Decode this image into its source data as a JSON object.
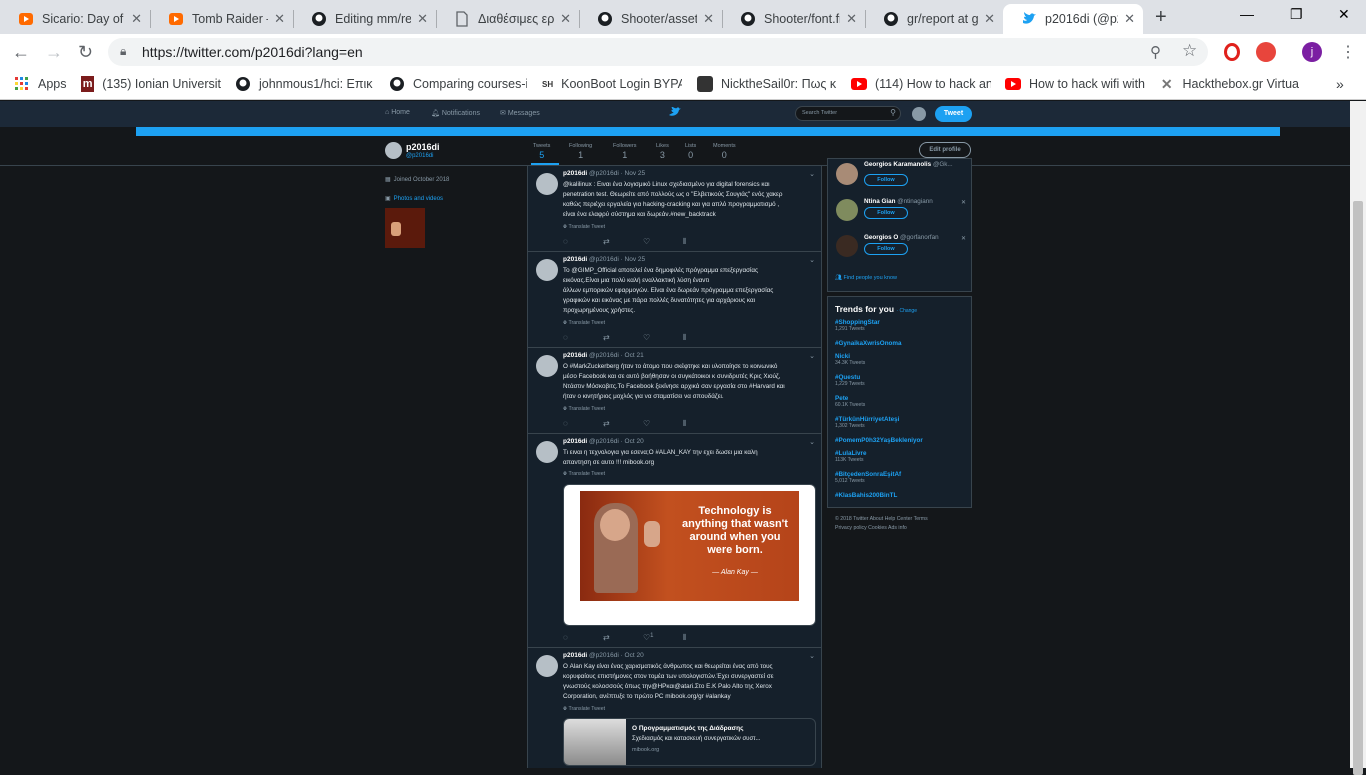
{
  "browser": {
    "tabs": [
      {
        "title": "Sicario: Day of",
        "icon": "youtube-icon"
      },
      {
        "title": "Tomb Raider –",
        "icon": "youtube-icon"
      },
      {
        "title": "Editing mm/re",
        "icon": "github-icon"
      },
      {
        "title": "Διαθέσιμες ερ",
        "icon": "document-icon"
      },
      {
        "title": "Shooter/assets",
        "icon": "github-icon"
      },
      {
        "title": "Shooter/font.fr",
        "icon": "github-icon"
      },
      {
        "title": "gr/report at gi",
        "icon": "github-icon"
      },
      {
        "title": "p2016di (@p2",
        "icon": "twitter-icon",
        "active": true
      }
    ],
    "url": "https://twitter.com/p2016di?lang=en",
    "profile_initial": "j",
    "bookmarks": [
      {
        "label": "Apps"
      },
      {
        "label": "(135) Ionian Universit"
      },
      {
        "label": "johnmous1/hci: Επικ"
      },
      {
        "label": "Comparing courses-i"
      },
      {
        "label": "KoonBoot Login BYPA"
      },
      {
        "label": "NicktheSail0r: Πως κ"
      },
      {
        "label": "(114) How to hack an"
      },
      {
        "label": "How to hack wifi with"
      },
      {
        "label": "Hackthebox.gr Virtua"
      }
    ],
    "bookmarks_more": "»",
    "bookmark_icon_texts": {
      "ionian": "m",
      "koonboot": "SH"
    }
  },
  "twitter": {
    "nav": {
      "home": "Home",
      "notifications": "Notifications",
      "messages": "Messages",
      "search_placeholder": "Search Twitter",
      "tweet_button": "Tweet"
    },
    "profile": {
      "name": "p2016di",
      "handle": "@p2016di",
      "joined": "Joined October 2018",
      "photos_label": "Photos and videos",
      "edit": "Edit profile",
      "stats": [
        {
          "label": "Tweets",
          "value": "5",
          "active": true
        },
        {
          "label": "Following",
          "value": "1"
        },
        {
          "label": "Followers",
          "value": "1"
        },
        {
          "label": "Likes",
          "value": "3"
        },
        {
          "label": "Lists",
          "value": "0"
        },
        {
          "label": "Moments",
          "value": "0"
        }
      ]
    },
    "translate_label": "Translate Tweet",
    "tweets": [
      {
        "name": "p2016di",
        "handle": "@p2016di",
        "date": "Nov 25",
        "text": [
          "@kalilinux : Ειναι ένα λογισμικό Linux σχεδιασμένο για digital forensics και",
          "penetration test. Θεωρείτε από πολλούς ως ο \"Ελβετικούς Σουγιάς\" ενός χακερ",
          "καθώς περιέχει εργαλεία για hacking-cracking και για απλό  προγραμματισμό ,",
          "είναι ένα ελαφρύ σύστημα και δωρεάν.#new_backtrack"
        ]
      },
      {
        "name": "p2016di",
        "handle": "@p2016di",
        "date": "Nov 25",
        "text": [
          "Το @GIMP_Official αποτελεί ένα δημοφιλές πρόγραμμα επεξεργασίας",
          "εικόνας.Είναι μια πολύ καλή εναλλακτική λύση έναντι",
          "άλλων εμπορικών εφαρμογών. Είναι ένα δωρεάν πρόγραμμα επεξεργασίας",
          "γραφικών και εικόνας με πάρα πολλές δυνατότητες για αρχάριους και",
          "προχωρημένους χρήστες."
        ]
      },
      {
        "name": "p2016di",
        "handle": "@p2016di",
        "date": "Oct 21",
        "text": [
          "Ο #MarkZuckerberg ήταν το άτομο που σκέφτηκε και υλοποίησε το κοινωνικό",
          "μέσο Facebook και σε αυτό βοήθησαν οι συγκάτοικοι κ συνιδρυτές  Κρις Χιούζ,",
          "Ντάστιν Μόσκοβιτς.Το Facebook ξεκίνησε αρχικά σαν εργασία στο #Harvard και",
          "ήταν ο κινητήριος μοχλός για να σταματίσει να σπουδάζει."
        ]
      },
      {
        "name": "p2016di",
        "handle": "@p2016di",
        "date": "Oct 20",
        "text": [
          "Τι ειναι η τεχνολογια για εσενα;Ο #ALAN_KAY την εχει δωσει μια  καλη",
          "απαντηση σε αυτο !!! mibook.org"
        ],
        "image_quote": [
          "Technology is",
          "anything that wasn't",
          "around when you",
          "were born."
        ],
        "image_attr": "— Alan Kay —",
        "likes": "1"
      },
      {
        "name": "p2016di",
        "handle": "@p2016di",
        "date": "Oct 20",
        "text": [
          "Ο Alan Kay είναι ένας χαρισματικός άνθρωπος και θεωρείται ένας από τους",
          "κορυφαίους επιστήμονες στον τομέα των υπολογιστών.Έχει συνεργαστεί  σε",
          "γνωστούς κολοσσούς όπως την@HPκαι@atari.Στο Ε.Κ Palo Alto της Xerox",
          "Corporation, ανέπτυξε το πρώτο PC mibook.org/gr  #alankay"
        ],
        "card": {
          "title": "Ο Προγραμματισμός της Διάδρασης",
          "desc": "Σχεδιασμός και κατασκευή συνεργατικών συστ...",
          "domain": "mibook.org"
        }
      }
    ],
    "who_to_follow": [
      {
        "name": "Georgios Karamanolis",
        "handle": "@Gk...",
        "follow": "Follow"
      },
      {
        "name": "Ntina Gian",
        "handle": "@ntinagiann",
        "follow": "Follow"
      },
      {
        "name": "Georgios O",
        "handle": "@gorfanorfan",
        "follow": "Follow"
      }
    ],
    "find_people": "Find people you know",
    "trends_title": "Trends for you",
    "trends_change": "· Change",
    "trends": [
      {
        "tag": "#ShoppingStar",
        "count": "1,291 Tweets"
      },
      {
        "tag": "#GynaikaXwrisOnoma",
        "count": ""
      },
      {
        "tag": "Nicki",
        "count": "34.3K Tweets"
      },
      {
        "tag": "#Questu",
        "count": "1,229 Tweets"
      },
      {
        "tag": "Pete",
        "count": "60.1K Tweets"
      },
      {
        "tag": "#TürkünHürriyetAteşi",
        "count": "1,302 Tweets"
      },
      {
        "tag": "#PomemP0h32YaşBekleniyor",
        "count": ""
      },
      {
        "tag": "#LulaLivre",
        "count": "113K Tweets"
      },
      {
        "tag": "#BitçedenSonraEşitAf",
        "count": "5,012 Tweets"
      },
      {
        "tag": "#KlasBahis200BinTL",
        "count": ""
      }
    ],
    "footer_line1": "© 2018 Twitter   About   Help Center   Terms",
    "footer_line2": "Privacy policy   Cookies   Ads info"
  },
  "colors": {
    "accent": "#1da1f2",
    "bg": "#14171a",
    "card": "#15202b",
    "muted": "#8899a6"
  }
}
